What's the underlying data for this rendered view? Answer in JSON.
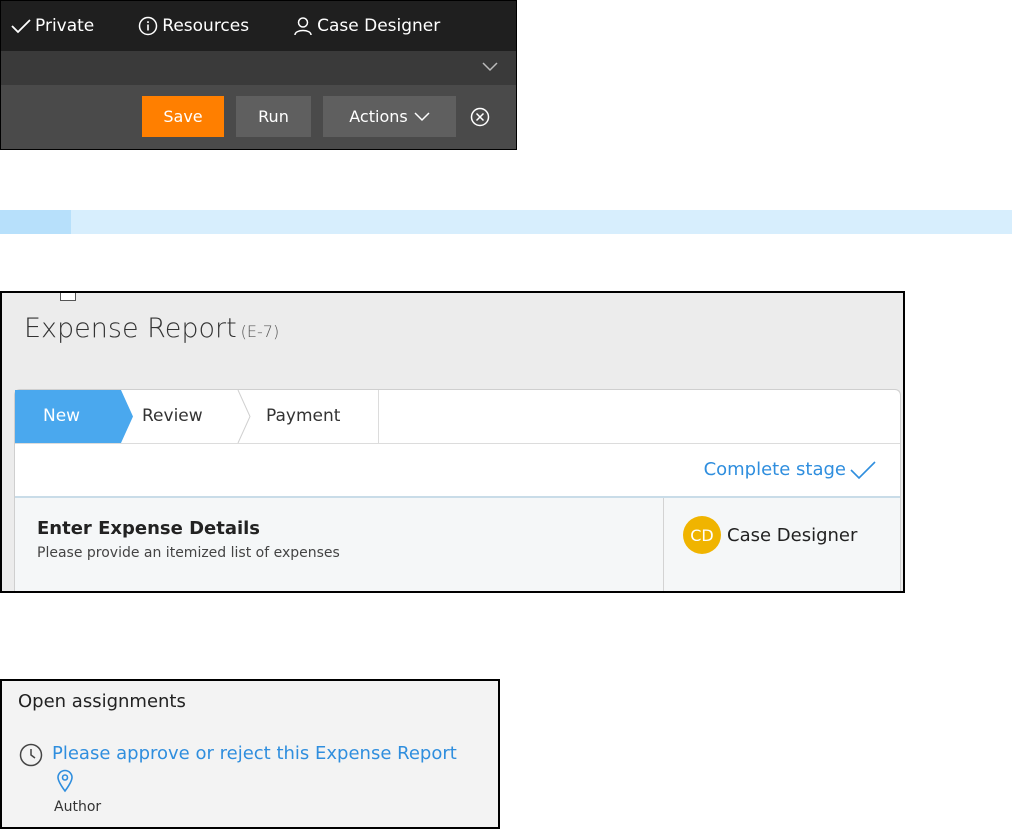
{
  "toolbar": {
    "items": [
      {
        "label": "Private",
        "icon": "checkmark-icon"
      },
      {
        "label": "Resources",
        "icon": "info-icon"
      },
      {
        "label": "Case Designer",
        "icon": "user-icon"
      }
    ],
    "buttons": {
      "save": "Save",
      "run": "Run",
      "actions": "Actions"
    },
    "colors": {
      "save": "#ff7f00",
      "button": "#5f5f5f",
      "background": "#2e2e2e"
    }
  },
  "progress": {
    "fraction": 0.07,
    "color": "#b7e0fb"
  },
  "case": {
    "title": "Expense Report",
    "id": "(E-7)",
    "stages": [
      {
        "label": "New",
        "active": true
      },
      {
        "label": "Review",
        "active": false
      },
      {
        "label": "Payment",
        "active": false
      }
    ],
    "complete_stage": "Complete stage",
    "assignment": {
      "title": "Enter Expense Details",
      "description": "Please provide an itemized list of expenses",
      "assignee_initials": "CD",
      "assignee_name": "Case Designer"
    },
    "colors": {
      "active_stage": "#4aa8ee",
      "link": "#2f8ede",
      "avatar": "#f0b400"
    }
  },
  "open_assignments": {
    "title": "Open assignments",
    "link": "Please approve or reject this Expense Report",
    "role": "Author"
  }
}
